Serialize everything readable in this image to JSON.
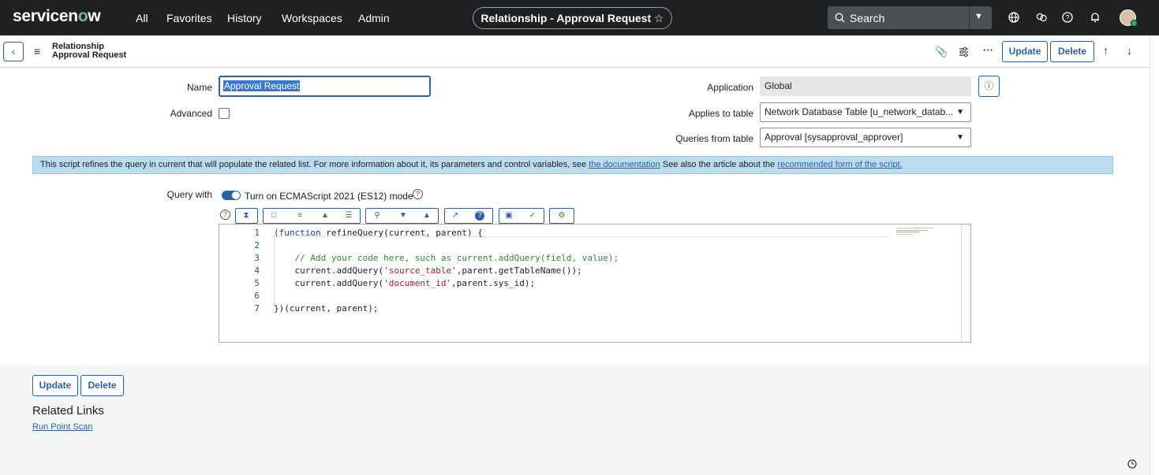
{
  "topbar": {
    "brand_prefix": "servicen",
    "brand_o": "o",
    "brand_suffix": "w",
    "nav": [
      "All",
      "Favorites",
      "History",
      "Workspaces",
      "Admin"
    ],
    "context_pill": "Relationship - Approval Request",
    "search_placeholder": "Search"
  },
  "header": {
    "title_line1": "Relationship",
    "title_line2": "Approval Request",
    "update_label": "Update",
    "delete_label": "Delete"
  },
  "form": {
    "name_label": "Name",
    "name_value": "Approval Request",
    "advanced_label": "Advanced",
    "application_label": "Application",
    "application_value": "Global",
    "applies_to_label": "Applies to table",
    "applies_to_value": "Network Database Table [u_network_datab...",
    "queries_from_label": "Queries from table",
    "queries_from_value": "Approval [sysapproval_approver]"
  },
  "notice": {
    "text1": "This script refines the query in current that will populate the related list. For more information about it, its parameters and control variables, see ",
    "link1": "the documentation",
    "text2": " See also the article about the ",
    "link2": "recommended form of the script."
  },
  "query": {
    "label": "Query with",
    "toggle_text": "Turn on ECMAScript 2021 (ES12) mode"
  },
  "code": {
    "line_numbers": [
      "1",
      "2",
      "3",
      "4",
      "5",
      "6",
      "7"
    ],
    "l1_a": "(function ",
    "l1_b": "refineQuery(current, parent) {",
    "l3": "    // Add your code here, such as current.addQuery(field, value);",
    "l4_a": "    current.addQuery(",
    "l4_b": "'source_table'",
    "l4_c": ",parent.getTableName());",
    "l5_a": "    current.addQuery(",
    "l5_b": "'document_id'",
    "l5_c": ",parent.sys_id);",
    "l7": "})(current, parent);"
  },
  "footer": {
    "update_label": "Update",
    "delete_label": "Delete",
    "related_links_title": "Related Links",
    "run_point_scan": "Run Point Scan"
  },
  "colors": {
    "topbar_bg": "#1e2021",
    "accent": "#2b5fa8",
    "notice_bg": "#bbdcef"
  }
}
